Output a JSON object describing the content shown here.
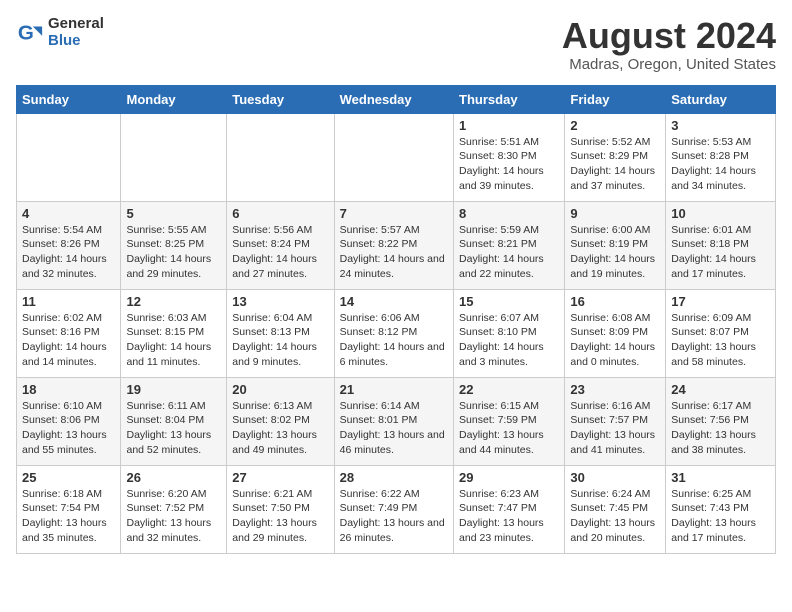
{
  "logo": {
    "general": "General",
    "blue": "Blue"
  },
  "title": "August 2024",
  "subtitle": "Madras, Oregon, United States",
  "days_of_week": [
    "Sunday",
    "Monday",
    "Tuesday",
    "Wednesday",
    "Thursday",
    "Friday",
    "Saturday"
  ],
  "weeks": [
    [
      {
        "day": "",
        "info": ""
      },
      {
        "day": "",
        "info": ""
      },
      {
        "day": "",
        "info": ""
      },
      {
        "day": "",
        "info": ""
      },
      {
        "day": "1",
        "info": "Sunrise: 5:51 AM\nSunset: 8:30 PM\nDaylight: 14 hours and 39 minutes."
      },
      {
        "day": "2",
        "info": "Sunrise: 5:52 AM\nSunset: 8:29 PM\nDaylight: 14 hours and 37 minutes."
      },
      {
        "day": "3",
        "info": "Sunrise: 5:53 AM\nSunset: 8:28 PM\nDaylight: 14 hours and 34 minutes."
      }
    ],
    [
      {
        "day": "4",
        "info": "Sunrise: 5:54 AM\nSunset: 8:26 PM\nDaylight: 14 hours and 32 minutes."
      },
      {
        "day": "5",
        "info": "Sunrise: 5:55 AM\nSunset: 8:25 PM\nDaylight: 14 hours and 29 minutes."
      },
      {
        "day": "6",
        "info": "Sunrise: 5:56 AM\nSunset: 8:24 PM\nDaylight: 14 hours and 27 minutes."
      },
      {
        "day": "7",
        "info": "Sunrise: 5:57 AM\nSunset: 8:22 PM\nDaylight: 14 hours and 24 minutes."
      },
      {
        "day": "8",
        "info": "Sunrise: 5:59 AM\nSunset: 8:21 PM\nDaylight: 14 hours and 22 minutes."
      },
      {
        "day": "9",
        "info": "Sunrise: 6:00 AM\nSunset: 8:19 PM\nDaylight: 14 hours and 19 minutes."
      },
      {
        "day": "10",
        "info": "Sunrise: 6:01 AM\nSunset: 8:18 PM\nDaylight: 14 hours and 17 minutes."
      }
    ],
    [
      {
        "day": "11",
        "info": "Sunrise: 6:02 AM\nSunset: 8:16 PM\nDaylight: 14 hours and 14 minutes."
      },
      {
        "day": "12",
        "info": "Sunrise: 6:03 AM\nSunset: 8:15 PM\nDaylight: 14 hours and 11 minutes."
      },
      {
        "day": "13",
        "info": "Sunrise: 6:04 AM\nSunset: 8:13 PM\nDaylight: 14 hours and 9 minutes."
      },
      {
        "day": "14",
        "info": "Sunrise: 6:06 AM\nSunset: 8:12 PM\nDaylight: 14 hours and 6 minutes."
      },
      {
        "day": "15",
        "info": "Sunrise: 6:07 AM\nSunset: 8:10 PM\nDaylight: 14 hours and 3 minutes."
      },
      {
        "day": "16",
        "info": "Sunrise: 6:08 AM\nSunset: 8:09 PM\nDaylight: 14 hours and 0 minutes."
      },
      {
        "day": "17",
        "info": "Sunrise: 6:09 AM\nSunset: 8:07 PM\nDaylight: 13 hours and 58 minutes."
      }
    ],
    [
      {
        "day": "18",
        "info": "Sunrise: 6:10 AM\nSunset: 8:06 PM\nDaylight: 13 hours and 55 minutes."
      },
      {
        "day": "19",
        "info": "Sunrise: 6:11 AM\nSunset: 8:04 PM\nDaylight: 13 hours and 52 minutes."
      },
      {
        "day": "20",
        "info": "Sunrise: 6:13 AM\nSunset: 8:02 PM\nDaylight: 13 hours and 49 minutes."
      },
      {
        "day": "21",
        "info": "Sunrise: 6:14 AM\nSunset: 8:01 PM\nDaylight: 13 hours and 46 minutes."
      },
      {
        "day": "22",
        "info": "Sunrise: 6:15 AM\nSunset: 7:59 PM\nDaylight: 13 hours and 44 minutes."
      },
      {
        "day": "23",
        "info": "Sunrise: 6:16 AM\nSunset: 7:57 PM\nDaylight: 13 hours and 41 minutes."
      },
      {
        "day": "24",
        "info": "Sunrise: 6:17 AM\nSunset: 7:56 PM\nDaylight: 13 hours and 38 minutes."
      }
    ],
    [
      {
        "day": "25",
        "info": "Sunrise: 6:18 AM\nSunset: 7:54 PM\nDaylight: 13 hours and 35 minutes."
      },
      {
        "day": "26",
        "info": "Sunrise: 6:20 AM\nSunset: 7:52 PM\nDaylight: 13 hours and 32 minutes."
      },
      {
        "day": "27",
        "info": "Sunrise: 6:21 AM\nSunset: 7:50 PM\nDaylight: 13 hours and 29 minutes."
      },
      {
        "day": "28",
        "info": "Sunrise: 6:22 AM\nSunset: 7:49 PM\nDaylight: 13 hours and 26 minutes."
      },
      {
        "day": "29",
        "info": "Sunrise: 6:23 AM\nSunset: 7:47 PM\nDaylight: 13 hours and 23 minutes."
      },
      {
        "day": "30",
        "info": "Sunrise: 6:24 AM\nSunset: 7:45 PM\nDaylight: 13 hours and 20 minutes."
      },
      {
        "day": "31",
        "info": "Sunrise: 6:25 AM\nSunset: 7:43 PM\nDaylight: 13 hours and 17 minutes."
      }
    ]
  ]
}
